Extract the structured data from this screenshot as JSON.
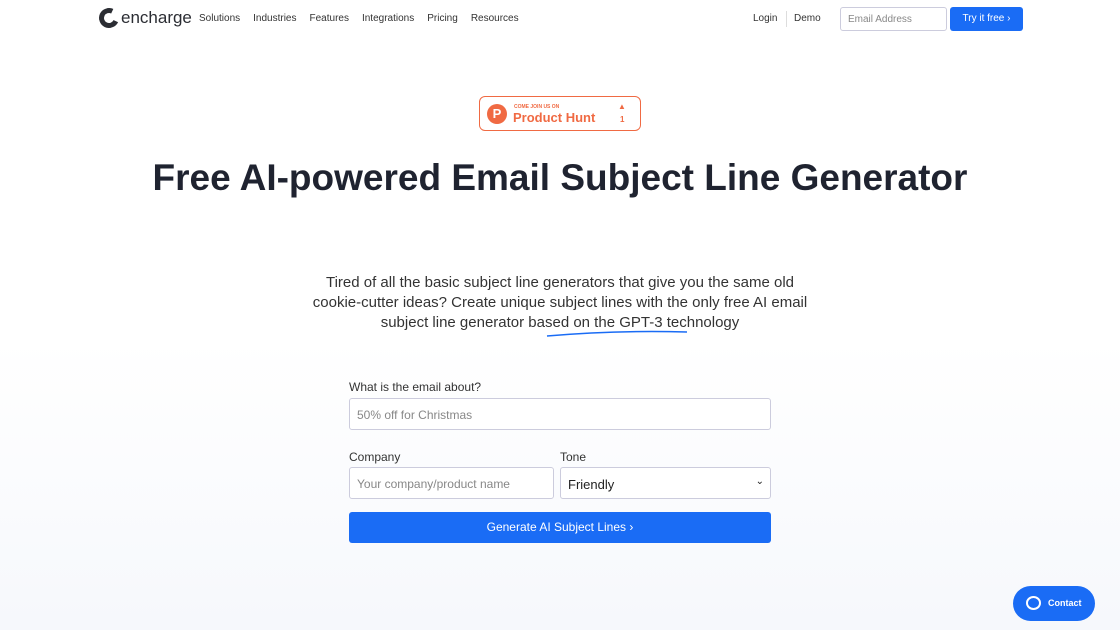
{
  "nav": {
    "brand": "encharge",
    "items": [
      "Solutions",
      "Industries",
      "Features",
      "Integrations",
      "Pricing",
      "Resources"
    ],
    "login": "Login",
    "demo": "Demo",
    "email_placeholder": "Email Address",
    "try": "Try it free ›"
  },
  "badge": {
    "small": "COME JOIN US ON",
    "big": "Product Hunt",
    "logo": "P",
    "up": "▲",
    "count": "1"
  },
  "hero": {
    "title": "Free AI-powered Email Subject Line Generator",
    "subtitle": "Tired of all the basic subject line generators that give you the same old cookie-cutter ideas? Create unique subject lines with the only free AI email subject line generator based on the GPT-3 technology"
  },
  "form": {
    "about_label": "What is the email about?",
    "about_placeholder": "50% off for Christmas",
    "company_label": "Company",
    "company_placeholder": "Your company/product name",
    "tone_label": "Tone",
    "tone_value": "Friendly",
    "submit": "Generate AI Subject Lines ›"
  },
  "contact": "Contact",
  "colors": {
    "accent": "#1a6cf5",
    "producthunt": "#f06a43"
  }
}
